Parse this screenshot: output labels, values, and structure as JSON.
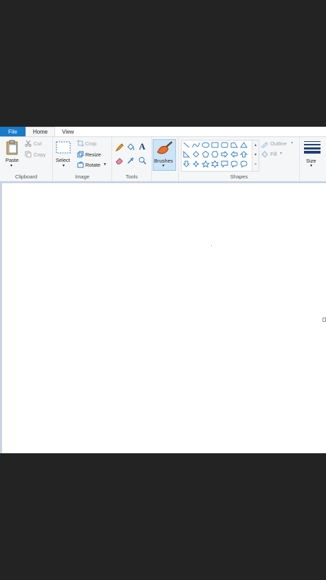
{
  "tabs": [
    {
      "label": "File"
    },
    {
      "label": "Home"
    },
    {
      "label": "View"
    }
  ],
  "clipboard": {
    "paste": "Paste",
    "cut": "Cut",
    "copy": "Copy",
    "label": "Clipboard"
  },
  "image": {
    "select": "Select",
    "crop": "Crop",
    "resize": "Resize",
    "rotate": "Rotate",
    "label": "Image"
  },
  "tools": {
    "label": "Tools"
  },
  "brushes": {
    "label": "Brushes"
  },
  "shapes": {
    "outline": "Outline",
    "fill": "Fill",
    "label": "Shapes"
  },
  "size": {
    "label": "Size"
  },
  "colors": {
    "accent": "#1979ca",
    "ribbon": "#f5f6f7",
    "workspace": "#c9d3e2",
    "icon": "#2b78c5"
  }
}
